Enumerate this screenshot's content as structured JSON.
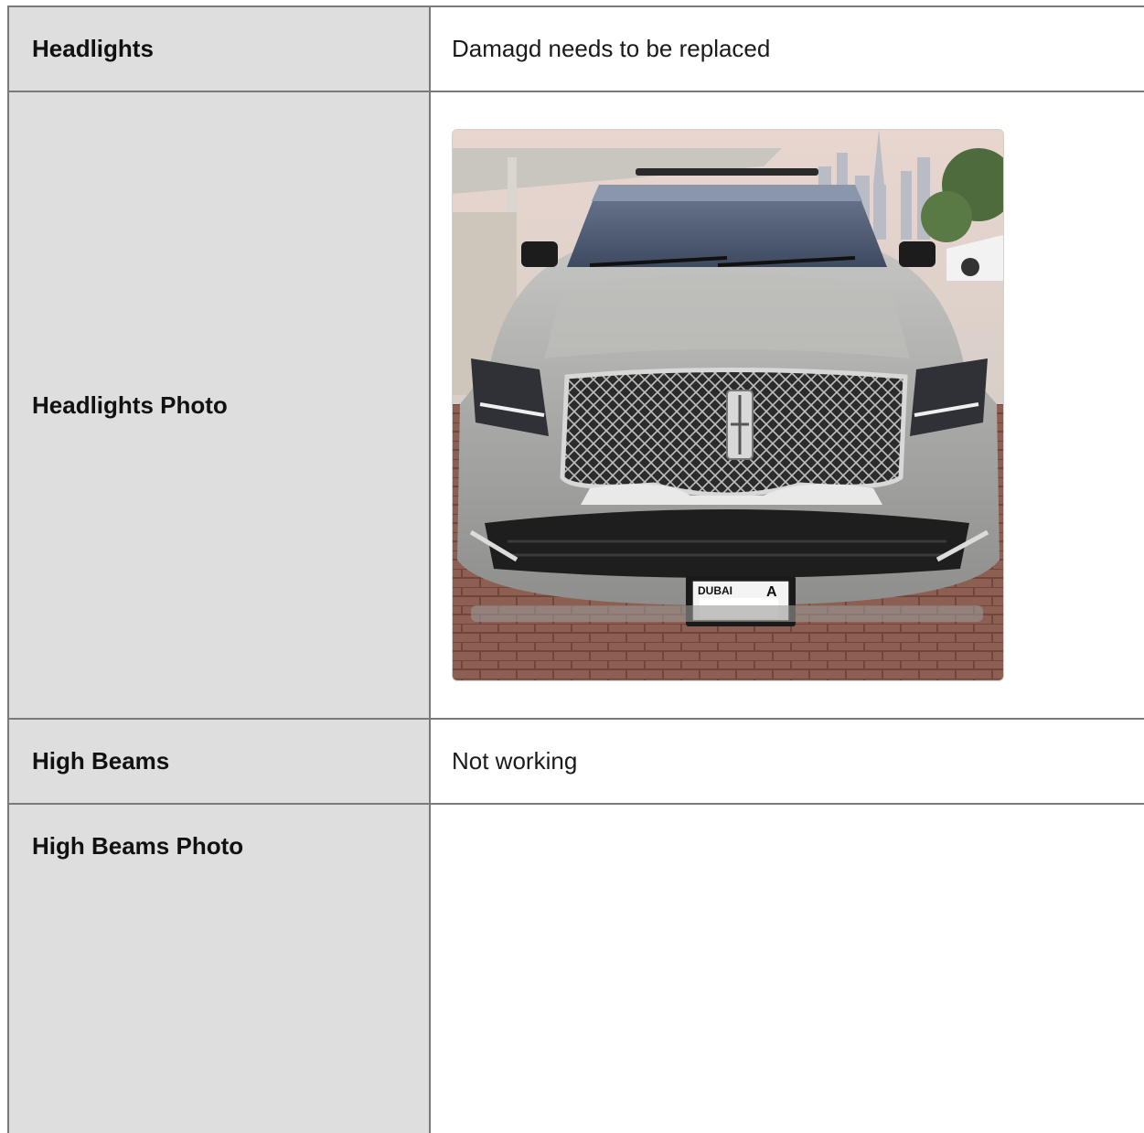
{
  "rows": {
    "headlights": {
      "label": "Headlights",
      "value": "Damagd needs to be replaced"
    },
    "headlights_photo": {
      "label": "Headlights Photo",
      "photo_icon": "car-front-photo"
    },
    "high_beams": {
      "label": "High Beams",
      "value": "Not working"
    },
    "high_beams_photo": {
      "label": "High Beams Photo",
      "value": ""
    }
  },
  "plate": {
    "emirate": "DUBAI",
    "code": "A"
  },
  "colors": {
    "label_bg": "#dedede",
    "border": "#7a7a7a",
    "car_body": "#a8a8a6",
    "grille": "#3a3a3a",
    "pavement": "#8a5a4e"
  }
}
